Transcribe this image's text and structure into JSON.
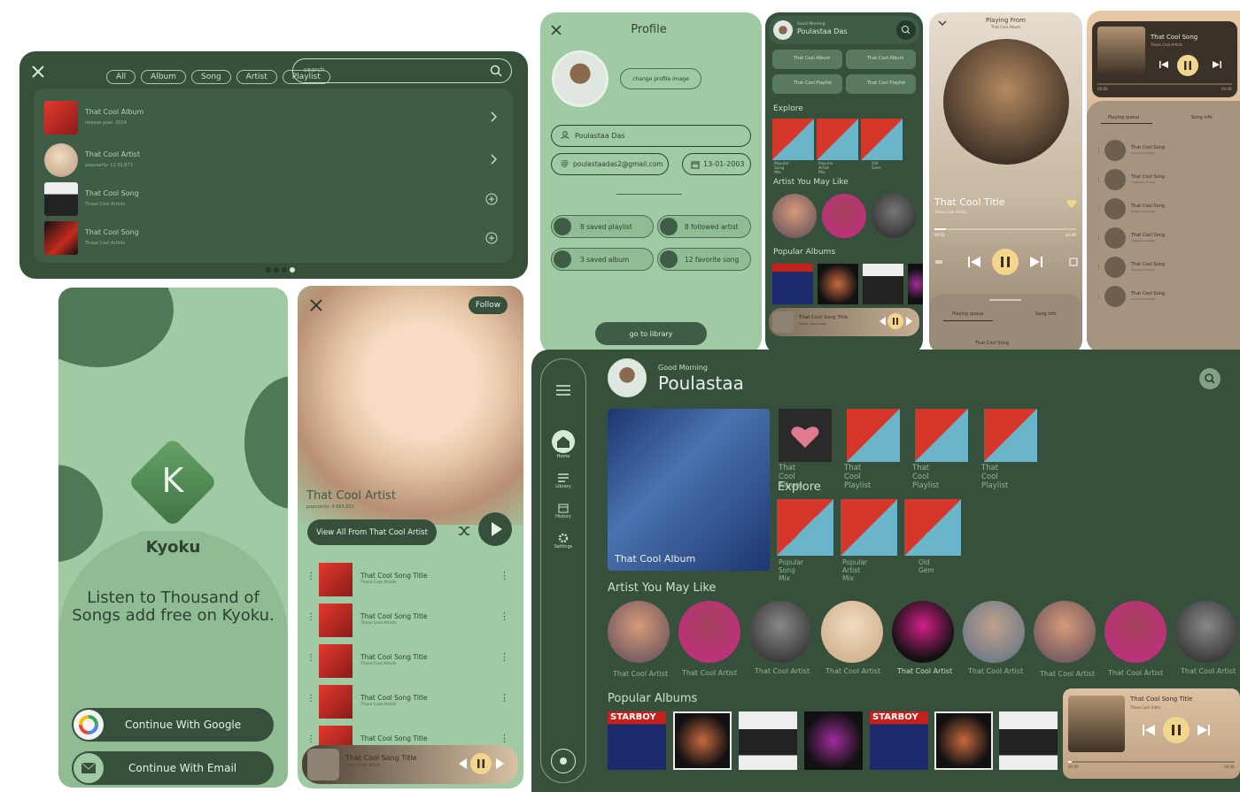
{
  "search_panel": {
    "filters": [
      "All",
      "Album",
      "Song",
      "Artist",
      "Playlist"
    ],
    "search_placeholder": "search",
    "results": [
      {
        "title": "That Cool Album",
        "subtitle": "release year: 2024",
        "action": "chevron"
      },
      {
        "title": "That Cool Artist",
        "subtitle": "popularity: 13.32,873",
        "action": "chevron"
      },
      {
        "title": "That Cool Song",
        "subtitle": "Those Cool Artists",
        "action": "add"
      },
      {
        "title": "That Cool Song",
        "subtitle": "Those Cool Artists",
        "action": "add"
      }
    ]
  },
  "profile": {
    "title": "Profile",
    "change_image": "change profile image",
    "name": "Poulastaa Das",
    "email": "poulastaadas2@gmail.com",
    "date": "13-01-2003",
    "stats": [
      "8 saved playlist",
      "8 followed artist",
      "3 saved album",
      "12 favorite song"
    ],
    "go_library": "go to library"
  },
  "mobile_home": {
    "greeting": "Good Morning",
    "name": "Poulastaa Das",
    "chips": [
      "That Cool Album",
      "That Cool Album",
      "That Cool Playlist",
      "That Cool Playlist"
    ],
    "explore": "Explore",
    "explore_items": [
      "Popular Song Mix",
      "Popular Artist Mix",
      "Old Gem"
    ],
    "artist_section": "Artist You May Like",
    "albums_section": "Popular Albums",
    "mini_title": "That Cool Song Title",
    "mini_sub": "Those Cool Artists"
  },
  "now_playing": {
    "header": "Playing From",
    "header_sub": "That Cool Album",
    "title": "That Cool Title",
    "artists": "Those Cool Artists",
    "time_start": "00:03",
    "time_end": "04:40",
    "tabs": [
      "Playing queue",
      "Song info"
    ],
    "queue_item": "That Cool Song"
  },
  "queue_panel": {
    "title": "That Cool Song",
    "sub": "Those Cool Artists",
    "time_start": "00:00",
    "time_end": "04:40",
    "tabs": [
      "Playing queue",
      "Song info"
    ],
    "items": [
      "That Cool Song",
      "That Cool Song",
      "That Cool Song",
      "That Cool Song",
      "That Cool Song",
      "That Cool Song"
    ],
    "item_sub": "Those Cool Artists"
  },
  "login": {
    "app_name": "Kyoku",
    "logo_letter": "K",
    "tagline": "Listen to Thousand of Songs add free on Kyoku.",
    "google": "Continue With Google",
    "email": "Continue With Email"
  },
  "artist_page": {
    "follow": "Follow",
    "name": "That Cool Artist",
    "popularity": "popularity: 4,563,001",
    "view_all": "View All From That Cool Artist",
    "song_title": "That Cool Song Title",
    "song_sub": "Those Cool Artists",
    "mini_title": "That Cool Song Title",
    "mini_sub": "Those Cool Artist"
  },
  "desktop": {
    "greeting": "Good Morning",
    "name": "Poulastaa",
    "nav": [
      "Home",
      "Library",
      "History",
      "Settings"
    ],
    "featured": "That Cool Album",
    "top_items": [
      "That Cool Album",
      "That Cool Playlist",
      "That Cool Playlist",
      "That Cool Playlist"
    ],
    "explore": "Explore",
    "explore_items": [
      "Popular Song Mix",
      "Popular Artist Mix",
      "Old Gem"
    ],
    "artist_section": "Artist You May Like",
    "artist_label": "That Cool Artist",
    "albums_section": "Popular Albums",
    "album_cover_text": "STARBOY",
    "mini_title": "That Cool Song Title",
    "mini_sub": "Those Cool Artist",
    "mini_start": "00:00",
    "mini_end": "04:40"
  },
  "colors": {
    "dark_green": "#36503c",
    "mid_green": "#3f5c46",
    "light_green": "#9fcaa3",
    "beige": "#c8ad8f"
  }
}
